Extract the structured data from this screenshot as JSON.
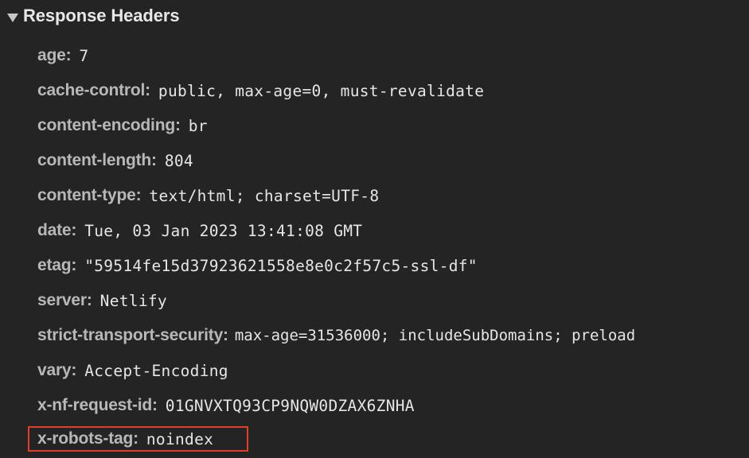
{
  "section": {
    "title": "Response Headers",
    "expanded_icon": "triangle-down-icon"
  },
  "headers": [
    {
      "name": "age:",
      "value": "7"
    },
    {
      "name": "cache-control:",
      "value": "public, max-age=0, must-revalidate"
    },
    {
      "name": "content-encoding:",
      "value": "br"
    },
    {
      "name": "content-length:",
      "value": "804"
    },
    {
      "name": "content-type:",
      "value": "text/html; charset=UTF-8"
    },
    {
      "name": "date:",
      "value": "Tue, 03 Jan 2023 13:41:08 GMT"
    },
    {
      "name": "etag:",
      "value": "\"59514fe15d37923621558e8e0c2f57c5-ssl-df\""
    },
    {
      "name": "server:",
      "value": "Netlify"
    },
    {
      "name": "strict-transport-security:",
      "value": "max-age=31536000; includeSubDomains; preload"
    },
    {
      "name": "vary:",
      "value": "Accept-Encoding"
    },
    {
      "name": "x-nf-request-id:",
      "value": "01GNVXTQ93CP9NQW0DZAX6ZNHA"
    },
    {
      "name": "x-robots-tag:",
      "value": "noindex"
    }
  ],
  "colors": {
    "background": "#242424",
    "header_name": "#b8b8b8",
    "header_value": "#e6e6e6",
    "highlight": "#e0402a"
  }
}
